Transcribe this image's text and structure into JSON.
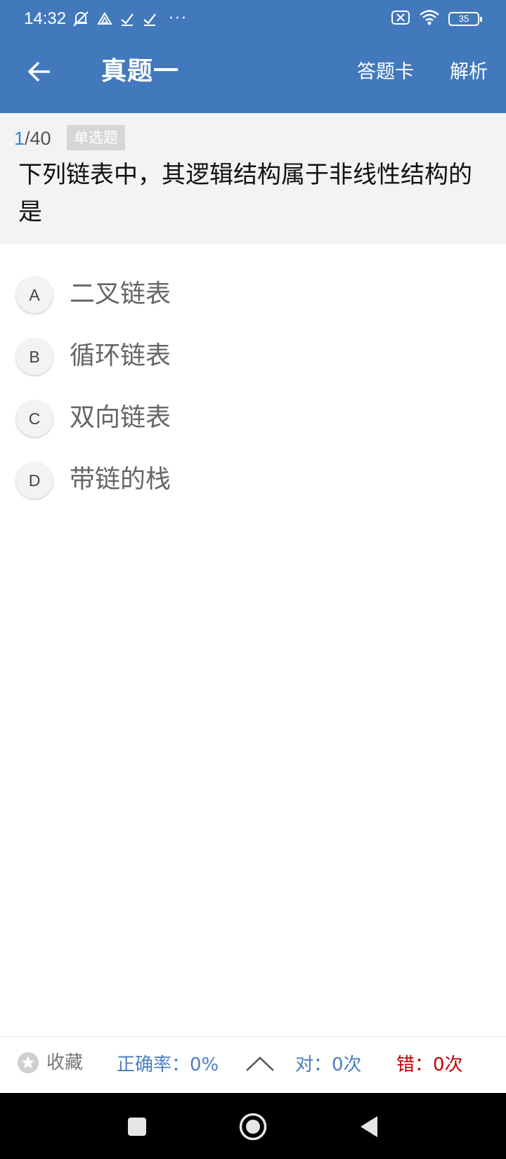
{
  "status_bar": {
    "time": "14:32",
    "more_dots": "···",
    "battery": "35"
  },
  "app_bar": {
    "title": "真题一",
    "answer_card_label": "答题卡",
    "analysis_label": "解析"
  },
  "question": {
    "current": "1",
    "total": "/40",
    "type": "单选题",
    "text": "下列链表中，其逻辑结构属于非线性结构的是"
  },
  "options": [
    {
      "letter": "A",
      "text": "二叉链表"
    },
    {
      "letter": "B",
      "text": "循环链表"
    },
    {
      "letter": "C",
      "text": "双向链表"
    },
    {
      "letter": "D",
      "text": "带链的栈"
    }
  ],
  "bottom_bar": {
    "favorite_label": "收藏",
    "accuracy": "正确率：0%",
    "correct": "对：0次",
    "wrong": "错：0次"
  },
  "colors": {
    "header_blue": "#4279bd",
    "accent_blue": "#4a7fc0",
    "counter_blue": "#2f86d6",
    "wrong_red": "#c00000"
  },
  "icons": [
    "back-arrow-icon",
    "star-icon",
    "chevron-up-icon",
    "nav-square-icon",
    "nav-home-icon",
    "nav-back-icon"
  ]
}
